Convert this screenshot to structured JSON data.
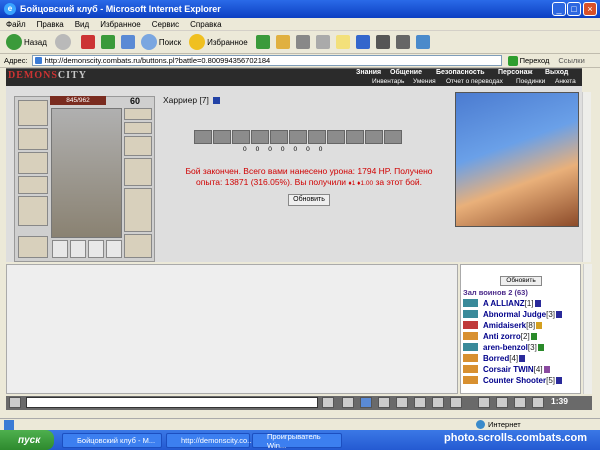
{
  "window": {
    "title": "Бойцовский клуб - Microsoft Internet Explorer"
  },
  "menu": [
    "Файл",
    "Правка",
    "Вид",
    "Избранное",
    "Сервис",
    "Справка"
  ],
  "toolbar": {
    "back": "Назад",
    "search": "Поиск",
    "favorites": "Избранное"
  },
  "address": {
    "label": "Адрес:",
    "url": "http://demonscity.combats.ru/buttons.pl?battle=0.800994356702184",
    "go": "Переход",
    "links": "Ссылки"
  },
  "game": {
    "logo_prefix": "DEMONS",
    "logo_suffix": "CITY",
    "nav_top": [
      "Знания",
      "Общение",
      "Безопасность",
      "Персонаж",
      "Выход"
    ],
    "nav_bottom": [
      "Инвентарь",
      "Умения",
      "Отчет о переводах",
      "Поединки",
      "Анкета"
    ],
    "hp": "845/962",
    "level": "60",
    "char_name": "Харриер",
    "char_level": "[7]",
    "counters": [
      "0",
      "0",
      "0",
      "0",
      "0",
      "0",
      "0"
    ],
    "result_lines": [
      "Бой закончен. Всего вами нанесено урона: 1794 HP. Получено",
      "опыта: 13871 (316.05%). Вы получили",
      "за этот бой."
    ],
    "reward_mark": "♦1 ♦1.00",
    "refresh": "Обновить"
  },
  "sidebar": {
    "refresh": "Обновить",
    "hall_title": "Зал воинов 2 (63)",
    "users": [
      {
        "name": "A ALLIANZ",
        "level": "[1]"
      },
      {
        "name": "Abnormal Judge",
        "level": "[3]"
      },
      {
        "name": "Amidaiserk",
        "level": "[8]"
      },
      {
        "name": "Anti zorro",
        "level": "[2]"
      },
      {
        "name": "aren-benzol",
        "level": "[3]"
      },
      {
        "name": "Borred",
        "level": "[4]"
      },
      {
        "name": "Corsair TWIN",
        "level": "[4]"
      },
      {
        "name": "Counter Shooter",
        "level": "[5]"
      }
    ]
  },
  "chatbar": {
    "clock": "1:39"
  },
  "statusbar": {
    "zone": "Интернет"
  },
  "taskbar": {
    "start": "пуск",
    "tasks": [
      "Бойцовский клуб - M...",
      "http://demonscity.co...",
      "Проигрыватель Win..."
    ],
    "watermark": "photo.scrolls.combats.com"
  }
}
